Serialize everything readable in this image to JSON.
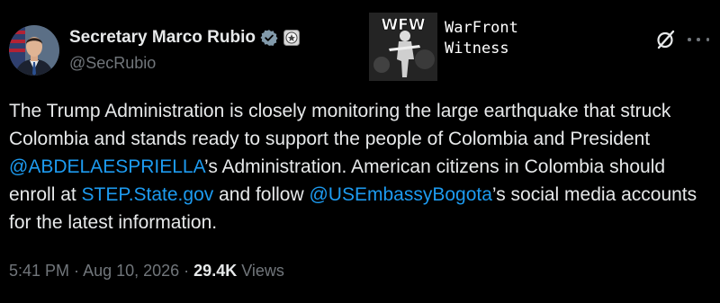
{
  "author": {
    "display_name": "Secretary Marco Rubio",
    "handle": "@SecRubio"
  },
  "watermark": {
    "logo_text": "WFW",
    "line1": "WarFront",
    "line2": "Witness"
  },
  "tweet": {
    "text_1": "The Trump Administration is closely monitoring the large earthquake that struck Colombia and stands ready to support the people of Colombia and President ",
    "mention_1": "@ABDELAESPRIELLA",
    "text_2": "’s Administration. American citizens in Colombia should enroll at ",
    "link_1": "STEP.State.gov",
    "text_3": " and follow ",
    "mention_2": "@USEmbassyBogota",
    "text_4": "’s social media accounts for the latest information."
  },
  "meta": {
    "time": "5:41 PM",
    "separator": " · ",
    "date": "Aug 10, 2026",
    "views_count": "29.4K",
    "views_label": " Views"
  },
  "icons": {
    "verified": "verified-badge-icon",
    "gov_badge": "government-seal-icon",
    "grok": "grok-icon",
    "more": "more-options-icon"
  },
  "colors": {
    "background": "#000000",
    "text": "#e7e9ea",
    "secondary": "#71767b",
    "link": "#1d9bf0",
    "verified": "#829aab"
  }
}
